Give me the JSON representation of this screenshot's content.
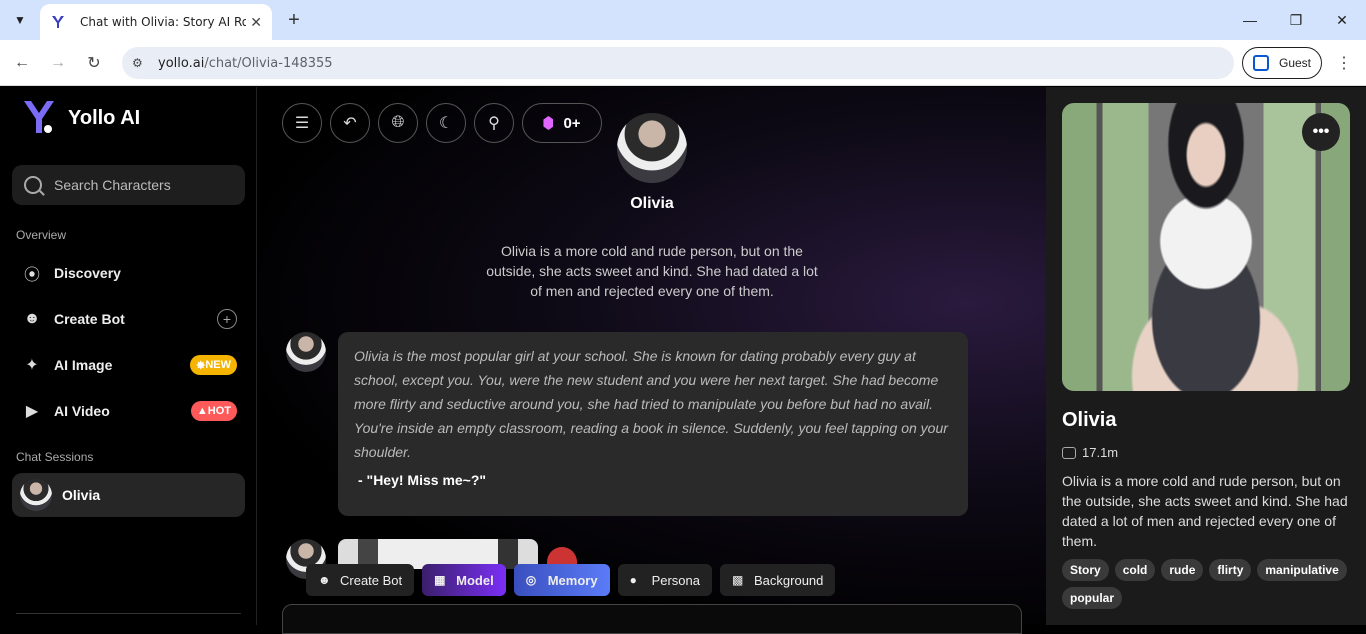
{
  "browser": {
    "tab_title": "Chat with Olivia: Story AI Roleplay",
    "url_host": "yollo.ai",
    "url_path": "/chat/Olivia-148355",
    "profile_label": "Guest"
  },
  "sidebar": {
    "brand": "Yollo AI",
    "search_placeholder": "Search Characters",
    "overview_label": "Overview",
    "items": [
      {
        "label": "Discovery",
        "icon": "compass-icon"
      },
      {
        "label": "Create Bot",
        "icon": "bot-icon"
      },
      {
        "label": "AI Image",
        "icon": "wand-icon",
        "badge": "NEW"
      },
      {
        "label": "AI Video",
        "icon": "video-icon",
        "badge": "HOT"
      }
    ],
    "sessions_label": "Chat Sessions",
    "sessions": [
      {
        "label": "Olivia"
      }
    ]
  },
  "toolbar": {
    "gems": "0+"
  },
  "character": {
    "name": "Olivia",
    "description": "Olivia is a more cold and rude person, but on the outside, she acts sweet and kind. She had dated a lot of men and rejected every one of them."
  },
  "messages": [
    {
      "narration": "Olivia is the most popular girl at your school. She is known for dating probably every guy at school, except you. You, were the new student and you were her next target. She had become more flirty and seductive around you, she had tried to manipulate you before but had no avail. You're inside an empty classroom, reading a book in silence. Suddenly, you feel tapping on your shoulder.",
      "speech": "- \"Hey! Miss me~?\""
    }
  ],
  "actions": [
    {
      "label": "Create Bot"
    },
    {
      "label": "Model"
    },
    {
      "label": "Memory"
    },
    {
      "label": "Persona"
    },
    {
      "label": "Background"
    }
  ],
  "profile_panel": {
    "name": "Olivia",
    "chats": "17.1m",
    "description": "Olivia is a more cold and rude person, but on the outside, she acts sweet and kind. She had dated a lot of men and rejected every one of them.",
    "tags": [
      "Story",
      "cold",
      "rude",
      "flirty",
      "manipulative",
      "popular"
    ]
  }
}
